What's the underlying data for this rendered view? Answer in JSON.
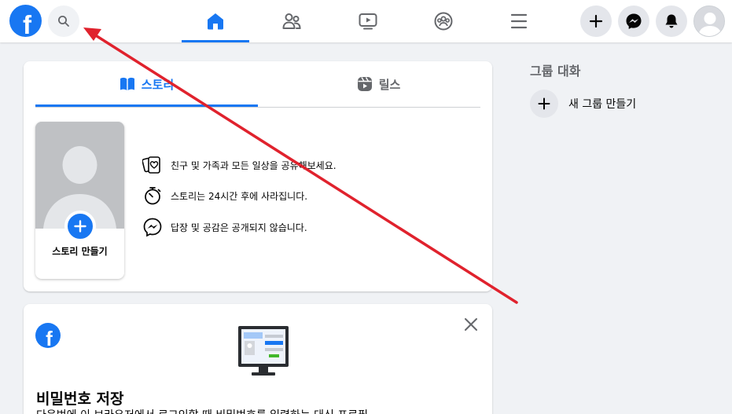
{
  "navbar": {
    "logo_letter": "f",
    "brand_color": "#1877f2",
    "search_icon": "search-icon",
    "tabs": [
      {
        "name": "home",
        "icon": "home-icon",
        "active": true
      },
      {
        "name": "friends",
        "icon": "friends-icon",
        "active": false
      },
      {
        "name": "watch",
        "icon": "video-icon",
        "active": false
      },
      {
        "name": "groups",
        "icon": "groups-icon",
        "active": false
      },
      {
        "name": "menu",
        "icon": "hamburger-icon",
        "active": false
      }
    ],
    "actions": [
      "plus-icon",
      "messenger-icon",
      "bell-icon"
    ]
  },
  "stories": {
    "tab_stories_label": "스토리",
    "tab_reels_label": "릴스",
    "create_story_label": "스토리 만들기",
    "info": [
      "친구 및 가족과 모든 일상을 공유해보세요.",
      "스토리는 24시간 후에 사라집니다.",
      "답장 및 공감은 공개되지 않습니다."
    ]
  },
  "password_card": {
    "title": "비밀번호 저장",
    "description": "다음번에 이 브라우저에서 로그인할 때 비밀번호를 입력하는 대신 프로필"
  },
  "right_column": {
    "group_chat_title": "그룹 대화",
    "new_group_label": "새 그룹 만들기"
  },
  "annotation": {
    "arrow_color": "#e0222d"
  }
}
